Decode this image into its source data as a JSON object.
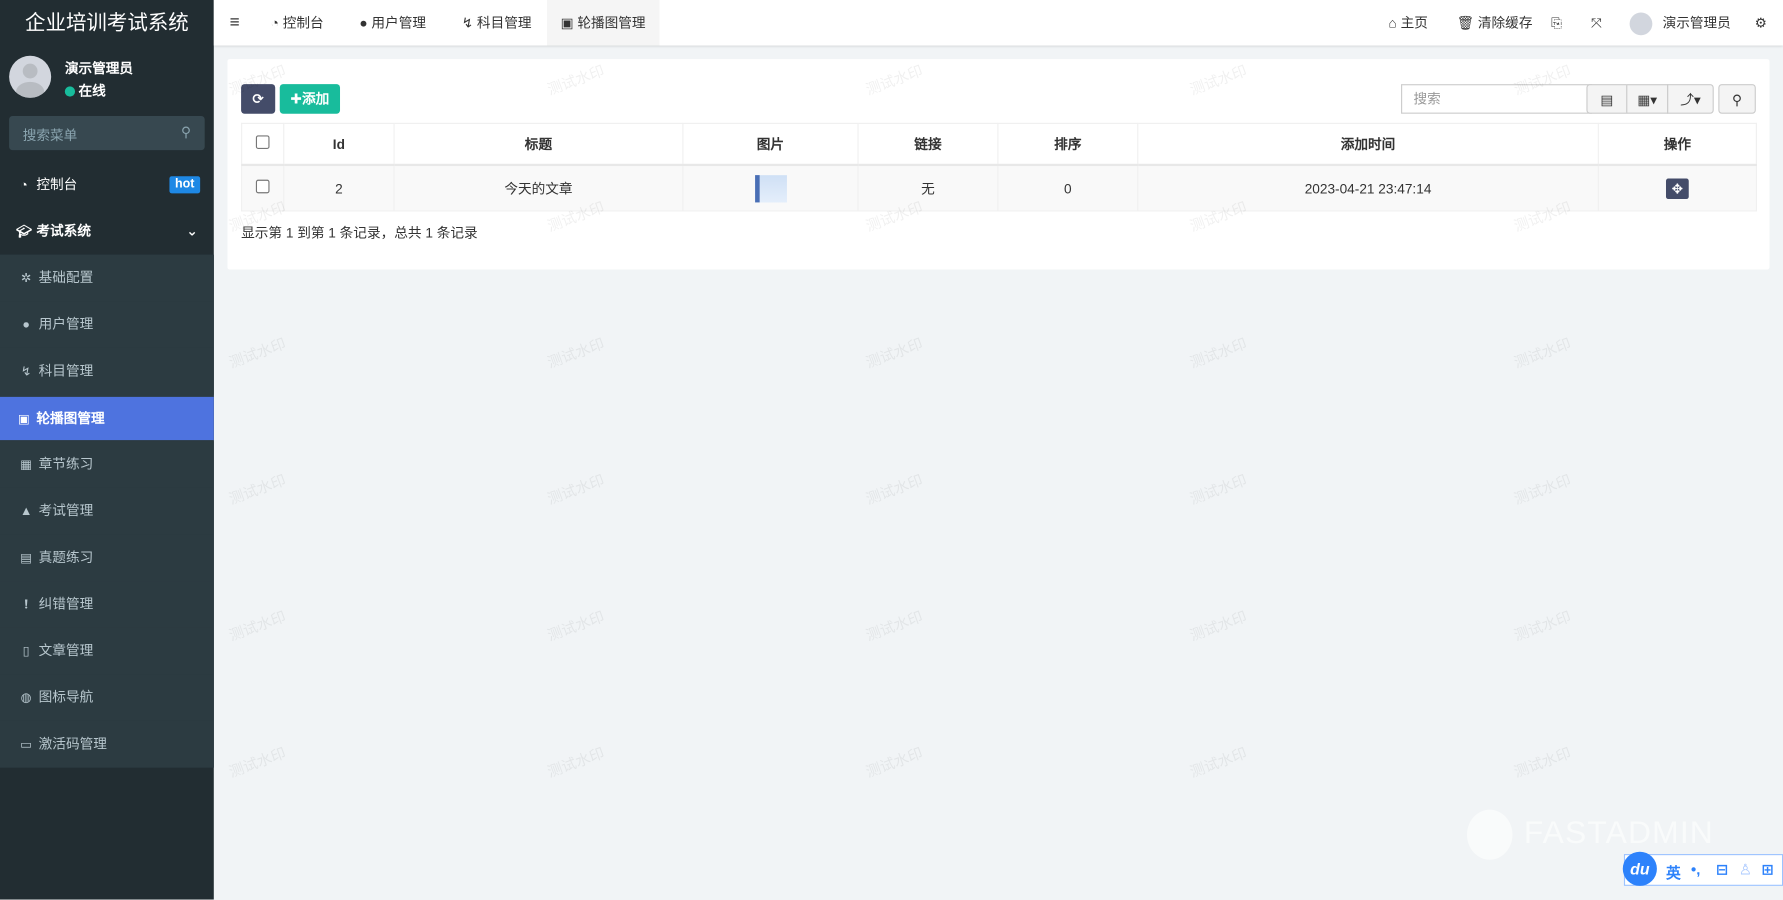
{
  "app_title": "企业培训考试系统",
  "user": {
    "name": "演示管理员",
    "status": "在线"
  },
  "menu_search": {
    "placeholder": "搜索菜单"
  },
  "menu": [
    {
      "label": "控制台",
      "icon": "dashboard-icon",
      "badge": "hot"
    },
    {
      "label": "考试系统",
      "icon": "graduation-cap-icon"
    },
    {
      "label": "基础配置",
      "icon": "gear-icon"
    },
    {
      "label": "用户管理",
      "icon": "user-icon"
    },
    {
      "label": "科目管理",
      "icon": "subject-icon"
    },
    {
      "label": "轮播图管理",
      "icon": "image-icon"
    },
    {
      "label": "章节练习",
      "icon": "grid-icon"
    },
    {
      "label": "考试管理",
      "icon": "graduation-cap-icon"
    },
    {
      "label": "真题练习",
      "icon": "list-icon"
    },
    {
      "label": "纠错管理",
      "icon": "exclamation-icon"
    },
    {
      "label": "文章管理",
      "icon": "file-icon"
    },
    {
      "label": "图标导航",
      "icon": "globe-icon"
    },
    {
      "label": "激活码管理",
      "icon": "card-icon"
    }
  ],
  "tabs": [
    "控制台",
    "用户管理",
    "科目管理",
    "轮播图管理"
  ],
  "header_right": {
    "home": "主页",
    "clear_cache": "清除缓存",
    "user": "演示管理员"
  },
  "toolbar": {
    "add": "添加",
    "search_placeholder": "搜索"
  },
  "table": {
    "columns": [
      "Id",
      "标题",
      "图片",
      "链接",
      "排序",
      "添加时间",
      "操作"
    ],
    "rows": [
      {
        "id": "2",
        "title": "今天的文章",
        "link": "无",
        "sort": "0",
        "time": "2023-04-21 23:47:14"
      }
    ]
  },
  "footer": "显示第 1 到第 1 条记录，总共 1 条记录",
  "watermark": "测试水印",
  "brand_watermark": "FASTADMIN",
  "ime": {
    "lang": "英",
    "punct": "•,"
  },
  "colors": {
    "sidebar": "#222d32",
    "active": "#4e73df",
    "add": "#18bc9c",
    "refresh": "#444c69"
  }
}
